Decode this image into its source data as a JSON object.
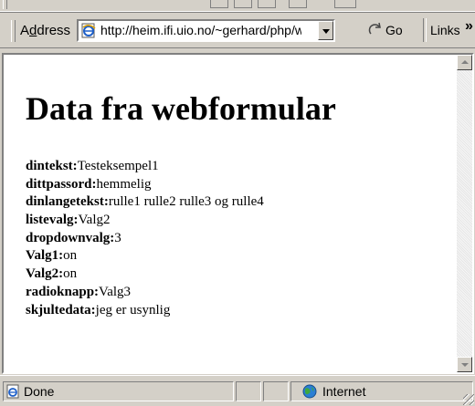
{
  "address_bar": {
    "label_prefix": "A",
    "label_underlined": "d",
    "label_suffix": "dress",
    "url": "http://heim.ifi.uio.no/~gerhard/php/we",
    "go_label": "Go",
    "links_label": "Links",
    "overflow_chevron": "»"
  },
  "page": {
    "title": "Data fra webformular",
    "fields": [
      {
        "key": "dintekst:",
        "value": "Testeksempel1"
      },
      {
        "key": "dittpassord:",
        "value": "hemmelig"
      },
      {
        "key": "dinlangetekst:",
        "value": "rulle1 rulle2 rulle3 og rulle4"
      },
      {
        "key": "listevalg:",
        "value": "Valg2"
      },
      {
        "key": "dropdownvalg:",
        "value": "3"
      },
      {
        "key": "Valg1:",
        "value": "on"
      },
      {
        "key": "Valg2:",
        "value": "on"
      },
      {
        "key": "radioknapp:",
        "value": "Valg3"
      },
      {
        "key": "skjultedata:",
        "value": "jeg er usynlig"
      }
    ]
  },
  "status_bar": {
    "status_text": "Done",
    "zone_text": "Internet"
  },
  "icons": {
    "page_icon": "ie-page-icon",
    "go_icon": "go-arrow-icon",
    "done_icon": "ie-page-icon",
    "zone_icon": "globe-icon"
  }
}
